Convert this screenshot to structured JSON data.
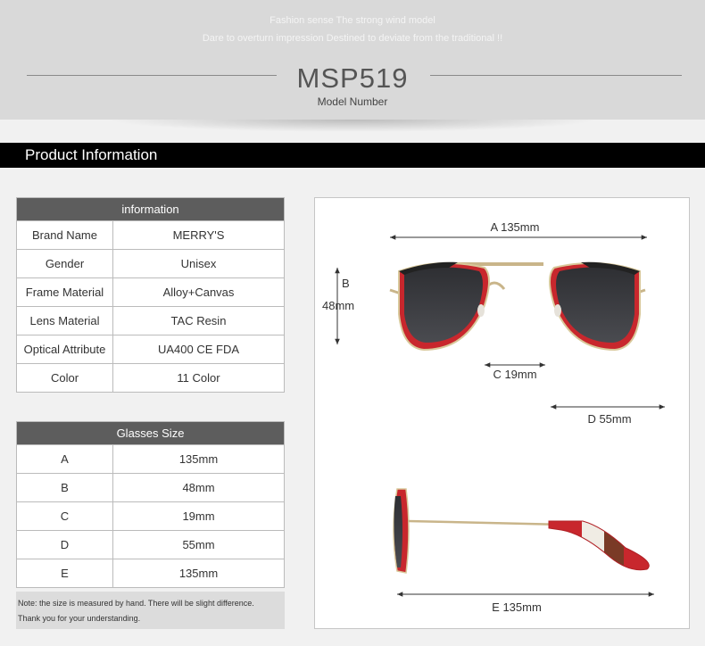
{
  "header": {
    "tagline_1": "Fashion sense The strong wind model",
    "tagline_2": "Dare to overturn impression Destined to deviate from the traditional !!",
    "model_number": "MSP519",
    "model_caption": "Model Number"
  },
  "section_title": "Product Information",
  "info_table": {
    "title": "information",
    "rows": [
      {
        "label": "Brand Name",
        "value": "MERRY'S"
      },
      {
        "label": "Gender",
        "value": "Unisex"
      },
      {
        "label": "Frame Material",
        "value": "Alloy+Canvas"
      },
      {
        "label": "Lens Material",
        "value": "TAC Resin"
      },
      {
        "label": "Optical Attribute",
        "value": "UA400 CE FDA"
      },
      {
        "label": "Color",
        "value": "11 Color"
      }
    ]
  },
  "size_table": {
    "title": "Glasses Size",
    "rows": [
      {
        "label": "A",
        "value": "135mm"
      },
      {
        "label": "B",
        "value": "48mm"
      },
      {
        "label": "C",
        "value": "19mm"
      },
      {
        "label": "D",
        "value": "55mm"
      },
      {
        "label": "E",
        "value": "135mm"
      }
    ]
  },
  "note": {
    "line_1": "Note: the size is measured by hand. There will be slight difference.",
    "line_2": "Thank you for your understanding."
  },
  "dimensions": {
    "a": "A 135mm",
    "b_letter": "B",
    "b_value": "48mm",
    "c": "C 19mm",
    "d": "D 55mm",
    "e": "E 135mm"
  },
  "colors": {
    "header_bg": "#d9d9d9",
    "bar_bg": "#000000",
    "table_header_bg": "#5d5d5d",
    "frame_red": "#c8272d",
    "lens_dark": "#3a3b3f",
    "metal_gold": "#c9b58a"
  }
}
